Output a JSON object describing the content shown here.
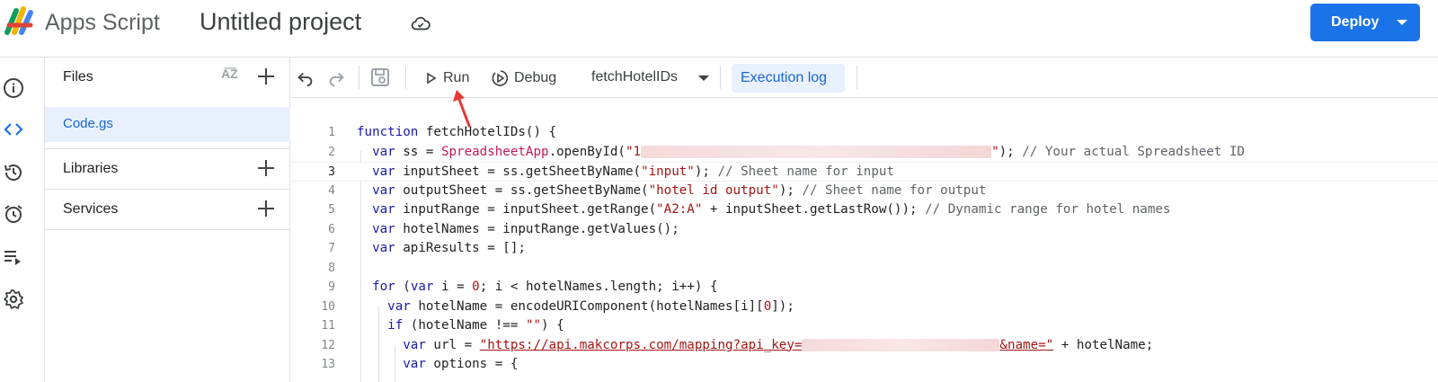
{
  "header": {
    "app_name": "Apps Script",
    "project_title": "Untitled project",
    "deploy_label": "Deploy"
  },
  "rail": {
    "icons": [
      "info-icon",
      "code-icon",
      "history-icon",
      "alarm-icon",
      "executions-icon",
      "settings-icon"
    ]
  },
  "files_panel": {
    "files_label": "Files",
    "files": [
      "Code.gs"
    ],
    "libraries_label": "Libraries",
    "services_label": "Services"
  },
  "toolbar": {
    "run_label": "Run",
    "debug_label": "Debug",
    "function_selected": "fetchHotelIDs",
    "execution_log_label": "Execution log"
  },
  "editor": {
    "current_line": 3,
    "line_numbers": [
      "1",
      "2",
      "3",
      "4",
      "5",
      "6",
      "7",
      "8",
      "9",
      "10",
      "11",
      "12",
      "13"
    ]
  },
  "colors": {
    "accent": "#1a73e8",
    "selected_bg": "#e8f0fe",
    "annotation_arrow": "#e53935"
  }
}
